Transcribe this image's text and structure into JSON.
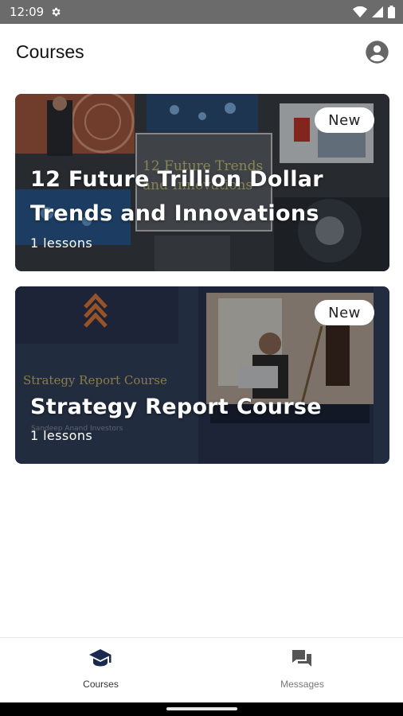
{
  "status_bar": {
    "time": "12:09"
  },
  "app_bar": {
    "title": "Courses",
    "account_icon": "account-circle-icon"
  },
  "courses": [
    {
      "title": "12 Future Trillion Dollar Trends and Innovations",
      "lessons": "1 lessons",
      "badge": "New",
      "thumbnail_text": "12 Future Trends and Innovations"
    },
    {
      "title": "Strategy Report Course",
      "lessons": "1 lessons",
      "badge": "New",
      "thumbnail_text": "Strategy Report Course",
      "thumbnail_subtext": "Sandeep Anand Investors"
    }
  ],
  "bottom_nav": {
    "items": [
      {
        "label": "Courses",
        "icon": "graduation-cap-icon",
        "active": true
      },
      {
        "label": "Messages",
        "icon": "chat-bubbles-icon",
        "active": false
      }
    ]
  },
  "colors": {
    "active_nav": "#1a2a4f",
    "inactive_nav": "#555555",
    "status_bar": "#6b6b6b"
  }
}
